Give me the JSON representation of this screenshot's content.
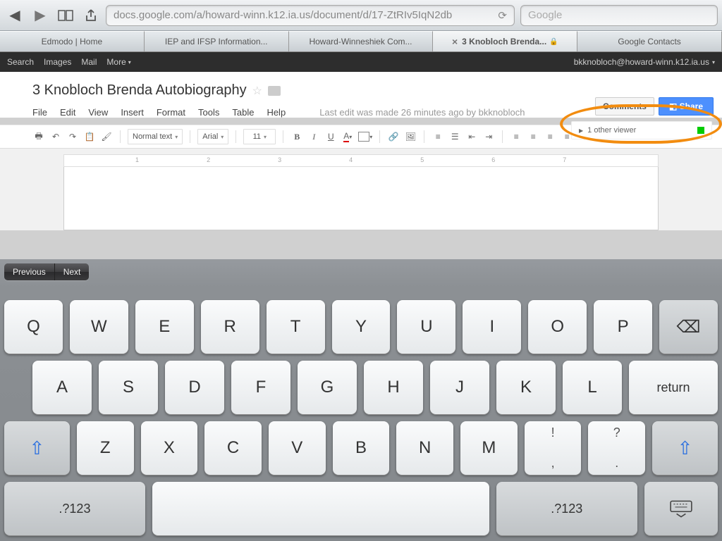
{
  "safari": {
    "url": "docs.google.com/a/howard-winn.k12.ia.us/document/d/17-ZtRIv5IqN2db",
    "searchPlaceholder": "Google"
  },
  "tabs": [
    {
      "label": "Edmodo | Home"
    },
    {
      "label": "IEP and IFSP Information..."
    },
    {
      "label": "Howard-Winneshiek Com..."
    },
    {
      "label": "3 Knobloch Brenda...",
      "active": true,
      "closeable": true,
      "locked": true
    },
    {
      "label": "Google Contacts"
    }
  ],
  "googleBar": {
    "items": [
      "Search",
      "Images",
      "Mail"
    ],
    "more": "More",
    "account": "bkknobloch@howard-winn.k12.ia.us"
  },
  "doc": {
    "title": "3 Knobloch Brenda Autobiography",
    "menus": [
      "File",
      "Edit",
      "View",
      "Insert",
      "Format",
      "Tools",
      "Table",
      "Help"
    ],
    "lastEdit": "Last edit was made 26 minutes ago by bkknobloch",
    "commentsBtn": "Comments",
    "shareBtn": "Share",
    "viewers": "1 other viewer",
    "styleSel": "Normal text",
    "fontSel": "Arial",
    "sizeSel": "11"
  },
  "ruler": [
    "1",
    "2",
    "3",
    "4",
    "5",
    "6",
    "7"
  ],
  "keyboard": {
    "prev": "Previous",
    "next": "Next",
    "row1": [
      "Q",
      "W",
      "E",
      "R",
      "T",
      "Y",
      "U",
      "I",
      "O",
      "P"
    ],
    "row2": [
      "A",
      "S",
      "D",
      "F",
      "G",
      "H",
      "J",
      "K",
      "L"
    ],
    "return": "return",
    "row3": [
      "Z",
      "X",
      "C",
      "V",
      "B",
      "N",
      "M"
    ],
    "punct1": {
      "top": "!",
      "bot": ","
    },
    "punct2": {
      "top": "?",
      "bot": "."
    },
    "numkey": ".?123"
  }
}
